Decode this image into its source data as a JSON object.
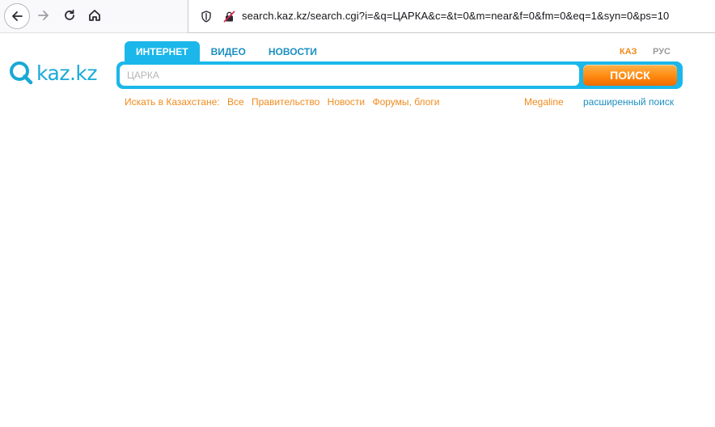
{
  "browser": {
    "url": "search.kaz.kz/search.cgi?i=&q=ЦАРКА&c=&t=0&m=near&f=0&fm=0&eq=1&syn=0&ps=10"
  },
  "logo": {
    "text": "kaz.kz"
  },
  "tabs": [
    {
      "label": "ИНТЕРНЕТ",
      "active": true
    },
    {
      "label": "ВИДЕО",
      "active": false
    },
    {
      "label": "НОВОСТИ",
      "active": false
    }
  ],
  "languages": {
    "kaz": "КАЗ",
    "rus": "РУС",
    "selected": "КАЗ"
  },
  "search": {
    "placeholder": "ЦАРКА",
    "button_label": "ПОИСК"
  },
  "filters": {
    "label": "Искать в Казахстане:",
    "items": [
      "Все",
      "Правительство",
      "Новости",
      "Форумы, блоги"
    ]
  },
  "megaline": "Megaline",
  "advanced_search": "расширенный поиск",
  "colors": {
    "brand_blue": "#1bb7ea",
    "link_blue": "#1b8fc1",
    "accent_orange": "#f08b1d",
    "button_orange": "#ff8a10"
  }
}
